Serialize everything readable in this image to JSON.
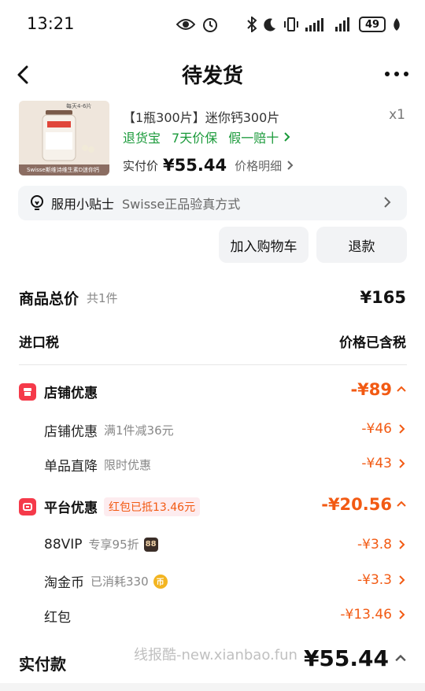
{
  "status_bar": {
    "time": "13:21",
    "battery": "49"
  },
  "nav": {
    "title": "待发货"
  },
  "product": {
    "title": "【1瓶300片】迷你钙300片",
    "quantity": "x1",
    "image_top_text": "每天4-6片",
    "image_bottom_text": "Swisse斯维诗维生素D迷你钙",
    "tags": [
      "退货宝",
      "7天价保",
      "假一赔十"
    ],
    "paid_label": "实付价",
    "paid_value": "¥55.44",
    "price_detail": "价格明细"
  },
  "tip": {
    "label": "服用小贴士",
    "text": "Swisse正品验真方式"
  },
  "buttons": {
    "add_cart": "加入购物车",
    "refund": "退款"
  },
  "summary": {
    "goods_total_label": "商品总价",
    "goods_count": "共1件",
    "goods_total_value": "¥165",
    "import_tax_label": "进口税",
    "import_tax_value": "价格已含税"
  },
  "store_discount": {
    "label": "店铺优惠",
    "total": "-¥89",
    "items": [
      {
        "label": "店铺优惠",
        "desc": "满1件减36元",
        "value": "-¥46"
      },
      {
        "label": "单品直降",
        "desc": "限时优惠",
        "value": "-¥43"
      }
    ]
  },
  "platform_discount": {
    "label": "平台优惠",
    "pill": "红包已抵13.46元",
    "total": "-¥20.56",
    "items": [
      {
        "label": "88VIP",
        "desc": "专享95折",
        "value": "-¥3.8",
        "badge": "88"
      },
      {
        "label": "淘金币",
        "desc": "已消耗330",
        "value": "-¥3.3",
        "badge": "币"
      },
      {
        "label": "红包",
        "desc": "",
        "value": "-¥13.46"
      }
    ]
  },
  "footer": {
    "paid_label": "实付款",
    "paid_value": "¥55.44",
    "watermark": "线报酷-new.xianbao.fun"
  },
  "colors": {
    "orange": "#f25a13",
    "green": "#1a9a3a",
    "red_icon": "#f53a4a"
  }
}
